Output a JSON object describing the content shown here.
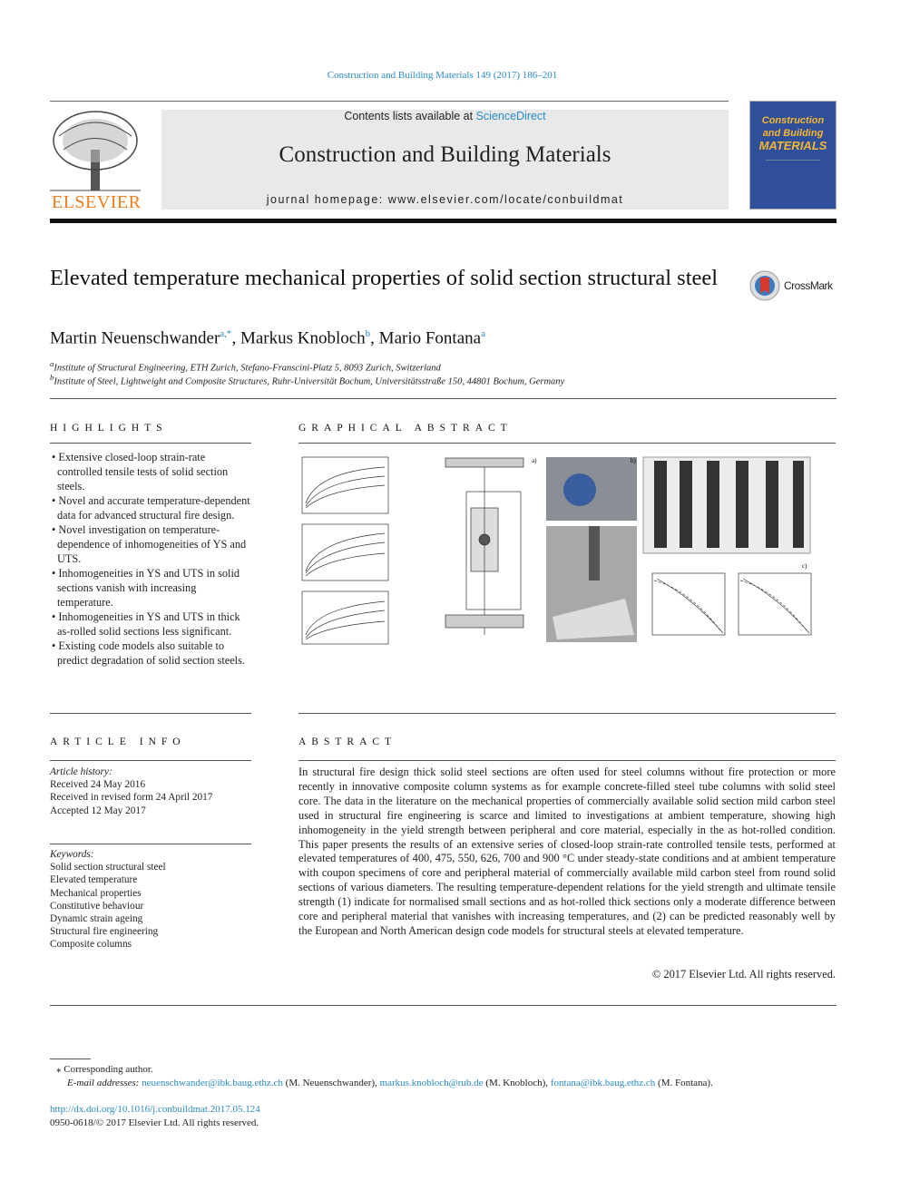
{
  "journal_ref": "Construction and Building Materials 149 (2017) 186–201",
  "header": {
    "contents_prefix": "Contents lists available at ",
    "sciencedirect": "ScienceDirect",
    "journal_title": "Construction and Building Materials",
    "homepage": "journal homepage: www.elsevier.com/locate/conbuildmat",
    "publisher": "ELSEVIER",
    "cover_lines": [
      "Construction",
      "and Building",
      "MATERIALS"
    ]
  },
  "crossmark": "CrossMark",
  "title": "Elevated temperature mechanical properties of solid section structural steel",
  "authors": [
    {
      "name": "Martin Neuenschwander",
      "sup": "a,*"
    },
    {
      "name": "Markus Knobloch",
      "sup": "b"
    },
    {
      "name": "Mario Fontana",
      "sup": "a"
    }
  ],
  "affiliations": [
    {
      "sup": "a",
      "text": "Institute of Structural Engineering, ETH Zurich, Stefano-Franscini-Platz 5, 8093 Zurich, Switzerland"
    },
    {
      "sup": "b",
      "text": "Institute of Steel, Lightweight and Composite Structures, Ruhr-Universität Bochum, Universitätsstraße 150, 44801 Bochum, Germany"
    }
  ],
  "highlights": {
    "heading": "HIGHLIGHTS",
    "items": [
      "Extensive closed-loop strain-rate controlled tensile tests of solid section steels.",
      "Novel and accurate temperature-dependent data for advanced structural fire design.",
      "Novel investigation on temperature-dependence of inhomogeneities of YS and UTS.",
      "Inhomogeneities in YS and UTS in solid sections vanish with increasing temperature.",
      "Inhomogeneities in YS and UTS in thick as-rolled solid sections less significant.",
      "Existing code models also suitable to predict degradation of solid section steels."
    ]
  },
  "graphical_abstract": {
    "heading": "GRAPHICAL ABSTRACT",
    "panel_labels": [
      "a)",
      "b)",
      "c)"
    ]
  },
  "article_info": {
    "heading": "ARTICLE INFO",
    "history_label": "Article history:",
    "history": [
      "Received 24 May 2016",
      "Received in revised form 24 April 2017",
      "Accepted 12 May 2017"
    ],
    "keywords_label": "Keywords:",
    "keywords": [
      "Solid section structural steel",
      "Elevated temperature",
      "Mechanical properties",
      "Constitutive behaviour",
      "Dynamic strain ageing",
      "Structural fire engineering",
      "Composite columns"
    ]
  },
  "abstract": {
    "heading": "ABSTRACT",
    "text": "In structural fire design thick solid steel sections are often used for steel columns without fire protection or more recently in innovative composite column systems as for example concrete-filled steel tube columns with solid steel core. The data in the literature on the mechanical properties of commercially available solid section mild carbon steel used in structural fire engineering is scarce and limited to investigations at ambient temperature, showing high inhomogeneity in the yield strength between peripheral and core material, especially in the as hot-rolled condition. This paper presents the results of an extensive series of closed-loop strain-rate controlled tensile tests, performed at elevated temperatures of 400, 475, 550, 626, 700 and 900 °C under steady-state conditions and at ambient temperature with coupon specimens of core and peripheral material of commercially available mild carbon steel from round solid sections of various diameters. The resulting temperature-dependent relations for the yield strength and ultimate tensile strength (1) indicate for normalised small sections and as hot-rolled thick sections only a moderate difference between core and peripheral material that vanishes with increasing temperatures, and (2) can be predicted reasonably well by the European and North American design code models for structural steels at elevated temperature.",
    "copyright": "© 2017 Elsevier Ltd. All rights reserved."
  },
  "footnotes": {
    "corresponding": "Corresponding author.",
    "email_label": "E-mail addresses:",
    "emails": [
      {
        "email": "neuenschwander@ibk.baug.ethz.ch",
        "who": "(M. Neuenschwander),"
      },
      {
        "email": "markus.knobloch@rub.de",
        "who": "(M. Knobloch),"
      },
      {
        "email": "fontana@ibk.baug.ethz.ch",
        "who": "(M. Fontana)."
      }
    ],
    "doi": "http://dx.doi.org/10.1016/j.conbuildmat.2017.05.124",
    "issn": "0950-0618/© 2017 Elsevier Ltd. All rights reserved."
  },
  "colors": {
    "link": "#2a8ac4",
    "elsevier": "#f07c1a",
    "banner": "#e9e9e9",
    "cover": "#2f4f9a"
  }
}
